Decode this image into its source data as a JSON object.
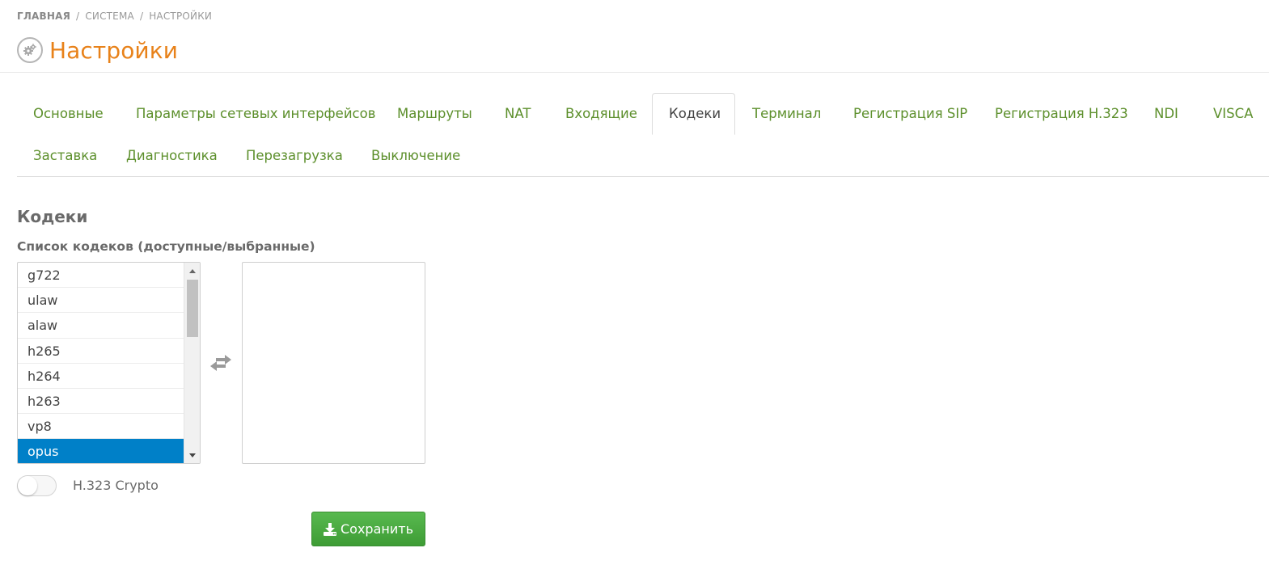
{
  "breadcrumb": {
    "home": "ГЛАВНАЯ",
    "separator": "/",
    "system": "СИСТЕМА",
    "current": "НАСТРОЙКИ"
  },
  "page": {
    "title": "Настройки",
    "icon": "gears-icon",
    "title_color": "#e8821a"
  },
  "tabs": [
    {
      "label": "Основные",
      "active": false
    },
    {
      "label": "Параметры сетевых интерфейсов",
      "active": false
    },
    {
      "label": "Маршруты",
      "active": false
    },
    {
      "label": "NAT",
      "active": false
    },
    {
      "label": "Входящие",
      "active": false
    },
    {
      "label": "Кодеки",
      "active": true
    },
    {
      "label": "Терминал",
      "active": false
    },
    {
      "label": "Регистрация SIP",
      "active": false
    },
    {
      "label": "Регистрация H.323",
      "active": false
    },
    {
      "label": "NDI",
      "active": false
    },
    {
      "label": "VISCA",
      "active": false
    },
    {
      "label": "Заставка",
      "active": false
    },
    {
      "label": "Диагностика",
      "active": false
    },
    {
      "label": "Перезагрузка",
      "active": false
    },
    {
      "label": "Выключение",
      "active": false
    }
  ],
  "section": {
    "title": "Кодеки",
    "codec_list_label": "Список кодеков (доступные/выбранные)",
    "available_codecs": [
      "g722",
      "ulaw",
      "alaw",
      "h265",
      "h264",
      "h263",
      "vp8",
      "opus"
    ],
    "selected_available_codec": "opus",
    "chosen_codecs": [],
    "swap_icon": "swap-arrows-icon",
    "h323_crypto": {
      "label": "H.323 Crypto",
      "enabled": false
    },
    "save_button": {
      "label": "Сохранить",
      "icon": "download-icon"
    }
  },
  "colors": {
    "accent": "#e8821a",
    "tab_link": "#5c8f2b",
    "selection": "#0080c8",
    "save_button": "#4cae43"
  }
}
